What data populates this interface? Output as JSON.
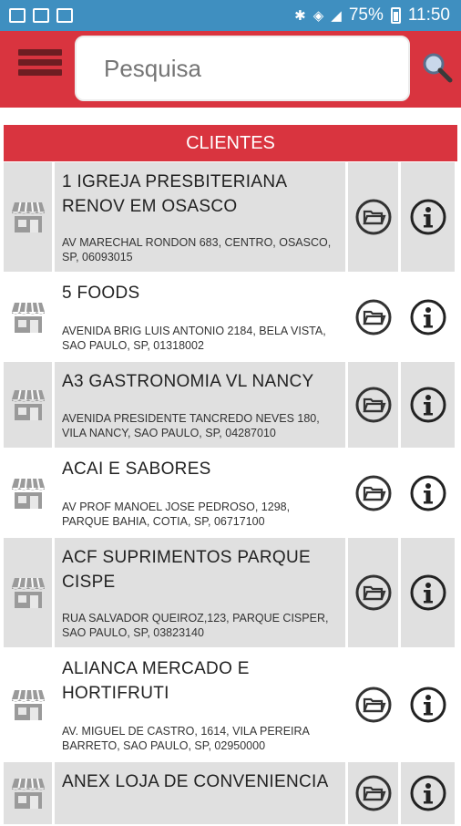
{
  "status_bar": {
    "battery": "75%",
    "time": "11:50"
  },
  "header": {
    "search_placeholder": "Pesquisa"
  },
  "section": {
    "title": "CLIENTES"
  },
  "clients": [
    {
      "name": "1 IGREJA PRESBITERIANA RENOV EM OSASCO",
      "address": "AV MARECHAL RONDON 683, CENTRO, OSASCO, SP, 06093015"
    },
    {
      "name": "5 FOODS",
      "address": "AVENIDA BRIG LUIS ANTONIO 2184, BELA VISTA, SAO PAULO, SP, 01318002"
    },
    {
      "name": "A3 GASTRONOMIA VL NANCY",
      "address": "AVENIDA PRESIDENTE TANCREDO NEVES 180, VILA NANCY, SAO PAULO, SP, 04287010"
    },
    {
      "name": "ACAI E SABORES",
      "address": "AV PROF MANOEL JOSE PEDROSO, 1298, PARQUE BAHIA, COTIA, SP, 06717100"
    },
    {
      "name": "ACF SUPRIMENTOS PARQUE CISPE",
      "address": "RUA SALVADOR QUEIROZ,123, PARQUE CISPER, SAO PAULO, SP, 03823140"
    },
    {
      "name": "ALIANCA MERCADO E HORTIFRUTI",
      "address": "AV. MIGUEL DE CASTRO, 1614, VILA PEREIRA BARRETO, SAO PAULO, SP, 02950000"
    },
    {
      "name": "ANEX LOJA DE CONVENIENCIA",
      "address": ""
    }
  ],
  "colors": {
    "header": "#d9343f",
    "status_bar": "#3f8fc0",
    "row_alt": "#e0e0e0"
  },
  "icons": {
    "store": "store-icon",
    "folder": "folder-icon",
    "info": "info-icon",
    "menu": "menu-icon",
    "search": "search-icon"
  }
}
